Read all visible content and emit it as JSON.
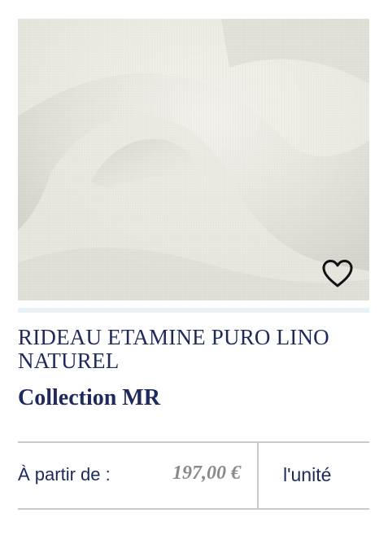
{
  "product": {
    "title": "RIDEAU ETAMINE PURO LINO NATUREL",
    "collection": "Collection MR",
    "image_alt": "linen etamine fabric photo",
    "favorite_icon": "heart-outline-icon",
    "carousel_progress": 0
  },
  "pricing": {
    "from_label": "À partir de :",
    "price": "197,00 €",
    "unit": "l'unité"
  },
  "colors": {
    "brand_navy": "#1f2a5c",
    "price_grey": "#8a8a8a",
    "progress_track": "#e8f1f6",
    "divider": "#c9c9c9"
  }
}
